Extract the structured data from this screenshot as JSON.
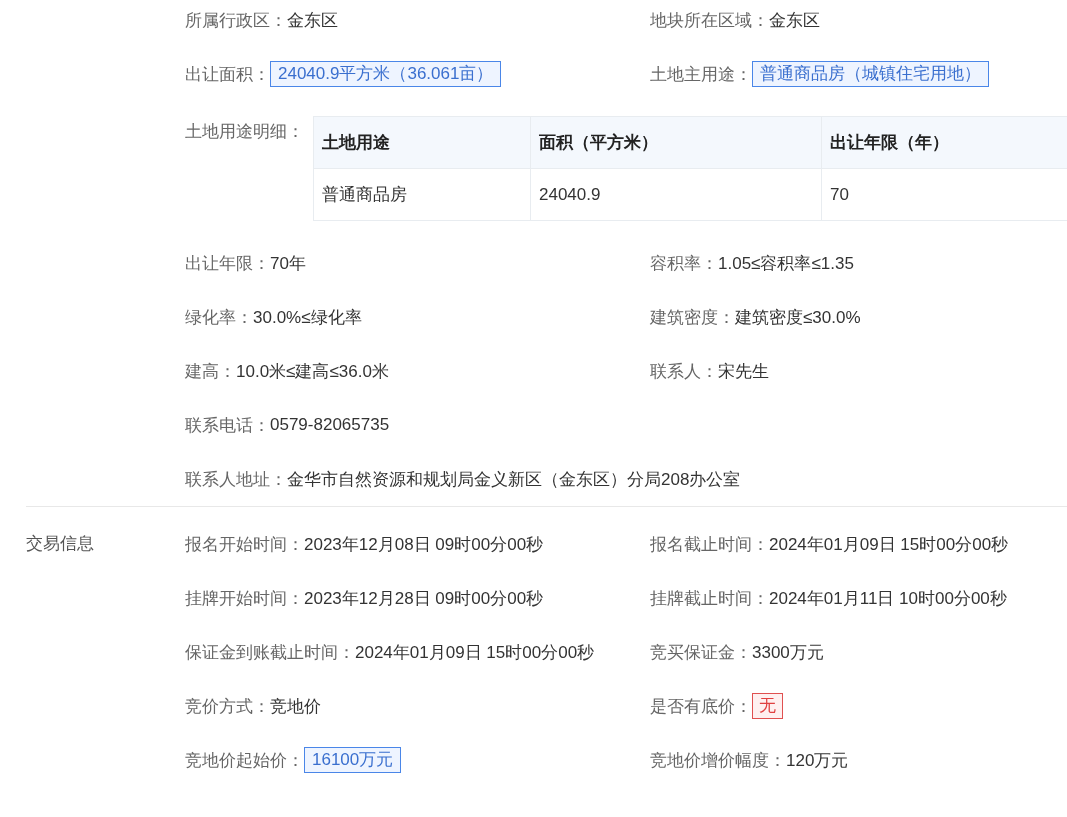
{
  "sections": [
    {
      "items": [
        {
          "kind": "text",
          "label": "所属行政区：",
          "value": "金东区"
        },
        {
          "kind": "text",
          "label": "地块所在区域：",
          "value": "金东区"
        },
        {
          "kind": "tag",
          "label": "出让面积：",
          "value": "24040.9平方米（36.061亩）"
        },
        {
          "kind": "tag",
          "label": "土地主用途：",
          "value": "普通商品房（城镇住宅用地）"
        },
        {
          "kind": "table",
          "label": "土地用途明细：",
          "columns": [
            "土地用途",
            "面积（平方米）",
            "出让年限（年）"
          ],
          "rows": [
            [
              "普通商品房",
              "24040.9",
              "70"
            ]
          ]
        },
        {
          "kind": "text",
          "label": "出让年限：",
          "value": "70年"
        },
        {
          "kind": "text",
          "label": "容积率：",
          "value": "1.05≤容积率≤1.35"
        },
        {
          "kind": "text",
          "label": "绿化率：",
          "value": "30.0%≤绿化率"
        },
        {
          "kind": "text",
          "label": "建筑密度：",
          "value": "建筑密度≤30.0%"
        },
        {
          "kind": "text",
          "label": "建高：",
          "value": "10.0米≤建高≤36.0米"
        },
        {
          "kind": "text",
          "label": "联系人：",
          "value": "宋先生"
        },
        {
          "kind": "text",
          "label": "联系电话：",
          "value": "0579-82065735"
        },
        {
          "kind": "wide",
          "label": "联系人地址：",
          "value": "金华市自然资源和规划局金义新区（金东区）分局208办公室"
        }
      ]
    },
    {
      "title": "交易信息",
      "items": [
        {
          "kind": "text",
          "label": "报名开始时间：",
          "value": "2023年12月08日 09时00分00秒"
        },
        {
          "kind": "text",
          "label": "报名截止时间：",
          "value": "2024年01月09日 15时00分00秒"
        },
        {
          "kind": "text",
          "label": "挂牌开始时间：",
          "value": "2023年12月28日 09时00分00秒"
        },
        {
          "kind": "text",
          "label": "挂牌截止时间：",
          "value": "2024年01月11日 10时00分00秒"
        },
        {
          "kind": "text",
          "label": "保证金到账截止时间：",
          "value": "2024年01月09日 15时00分00秒"
        },
        {
          "kind": "text",
          "label": "竞买保证金：",
          "value": "3300万元"
        },
        {
          "kind": "text",
          "label": "竞价方式：",
          "value": "竞地价"
        },
        {
          "kind": "alert",
          "label": "是否有底价：",
          "value": "无"
        },
        {
          "kind": "tag",
          "label": "竞地价起始价：",
          "value": "16100万元"
        },
        {
          "kind": "text",
          "label": "竞地价增价幅度：",
          "value": "120万元"
        }
      ]
    }
  ]
}
